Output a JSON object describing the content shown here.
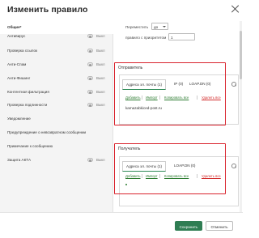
{
  "window": {
    "title": "Изменить правило"
  },
  "sidebar": {
    "items": [
      {
        "label": "Общие*",
        "toggle": ""
      },
      {
        "label": "Антивирус",
        "toggle": "Выкл"
      },
      {
        "label": "Проверка ссылок",
        "toggle": "Выкл"
      },
      {
        "label": "Анти-Спам",
        "toggle": "Выкл"
      },
      {
        "label": "Анти-Фишинг",
        "toggle": "Выкл"
      },
      {
        "label": "Контентная фильтрация",
        "toggle": "Выкл"
      },
      {
        "label": "Проверка подлинности",
        "toggle": "Выкл"
      },
      {
        "label": "Уведомление",
        "toggle": ""
      },
      {
        "label": "Предупреждение о невозвратном сообщении",
        "toggle": ""
      },
      {
        "label": "Примечание к сообщению",
        "toggle": ""
      },
      {
        "label": "Защита АКТА",
        "toggle": "Выкл"
      }
    ]
  },
  "general": {
    "move_label": "Переместить",
    "move_value": "до",
    "priority_label": "правило с приоритетом",
    "priority_value": "1"
  },
  "sender": {
    "section_label": "Отправитель",
    "tabs": [
      "Адреса эл. почты (1)",
      "IP (0)",
      "LOAP.DN (0)"
    ],
    "actions": [
      "Добавить",
      "Импорт",
      "Копировать все",
      "Удалить все"
    ],
    "entries": [
      "kamazabkiced-post.ru"
    ]
  },
  "recipient": {
    "section_label": "Получатель",
    "tabs": [
      "Адреса эл. почты (1)",
      "LOAP.DN (0)"
    ],
    "actions": [
      "Добавить",
      "Импорт",
      "Копировать все",
      "Удалить все"
    ],
    "entries": []
  },
  "footer": {
    "save_label": "Сохранить",
    "cancel_label": "Отменить"
  },
  "colors": {
    "accent": "#2f7d53",
    "highlight": "#d9232d",
    "link": "#2e7d32",
    "danger": "#d32f2f"
  }
}
